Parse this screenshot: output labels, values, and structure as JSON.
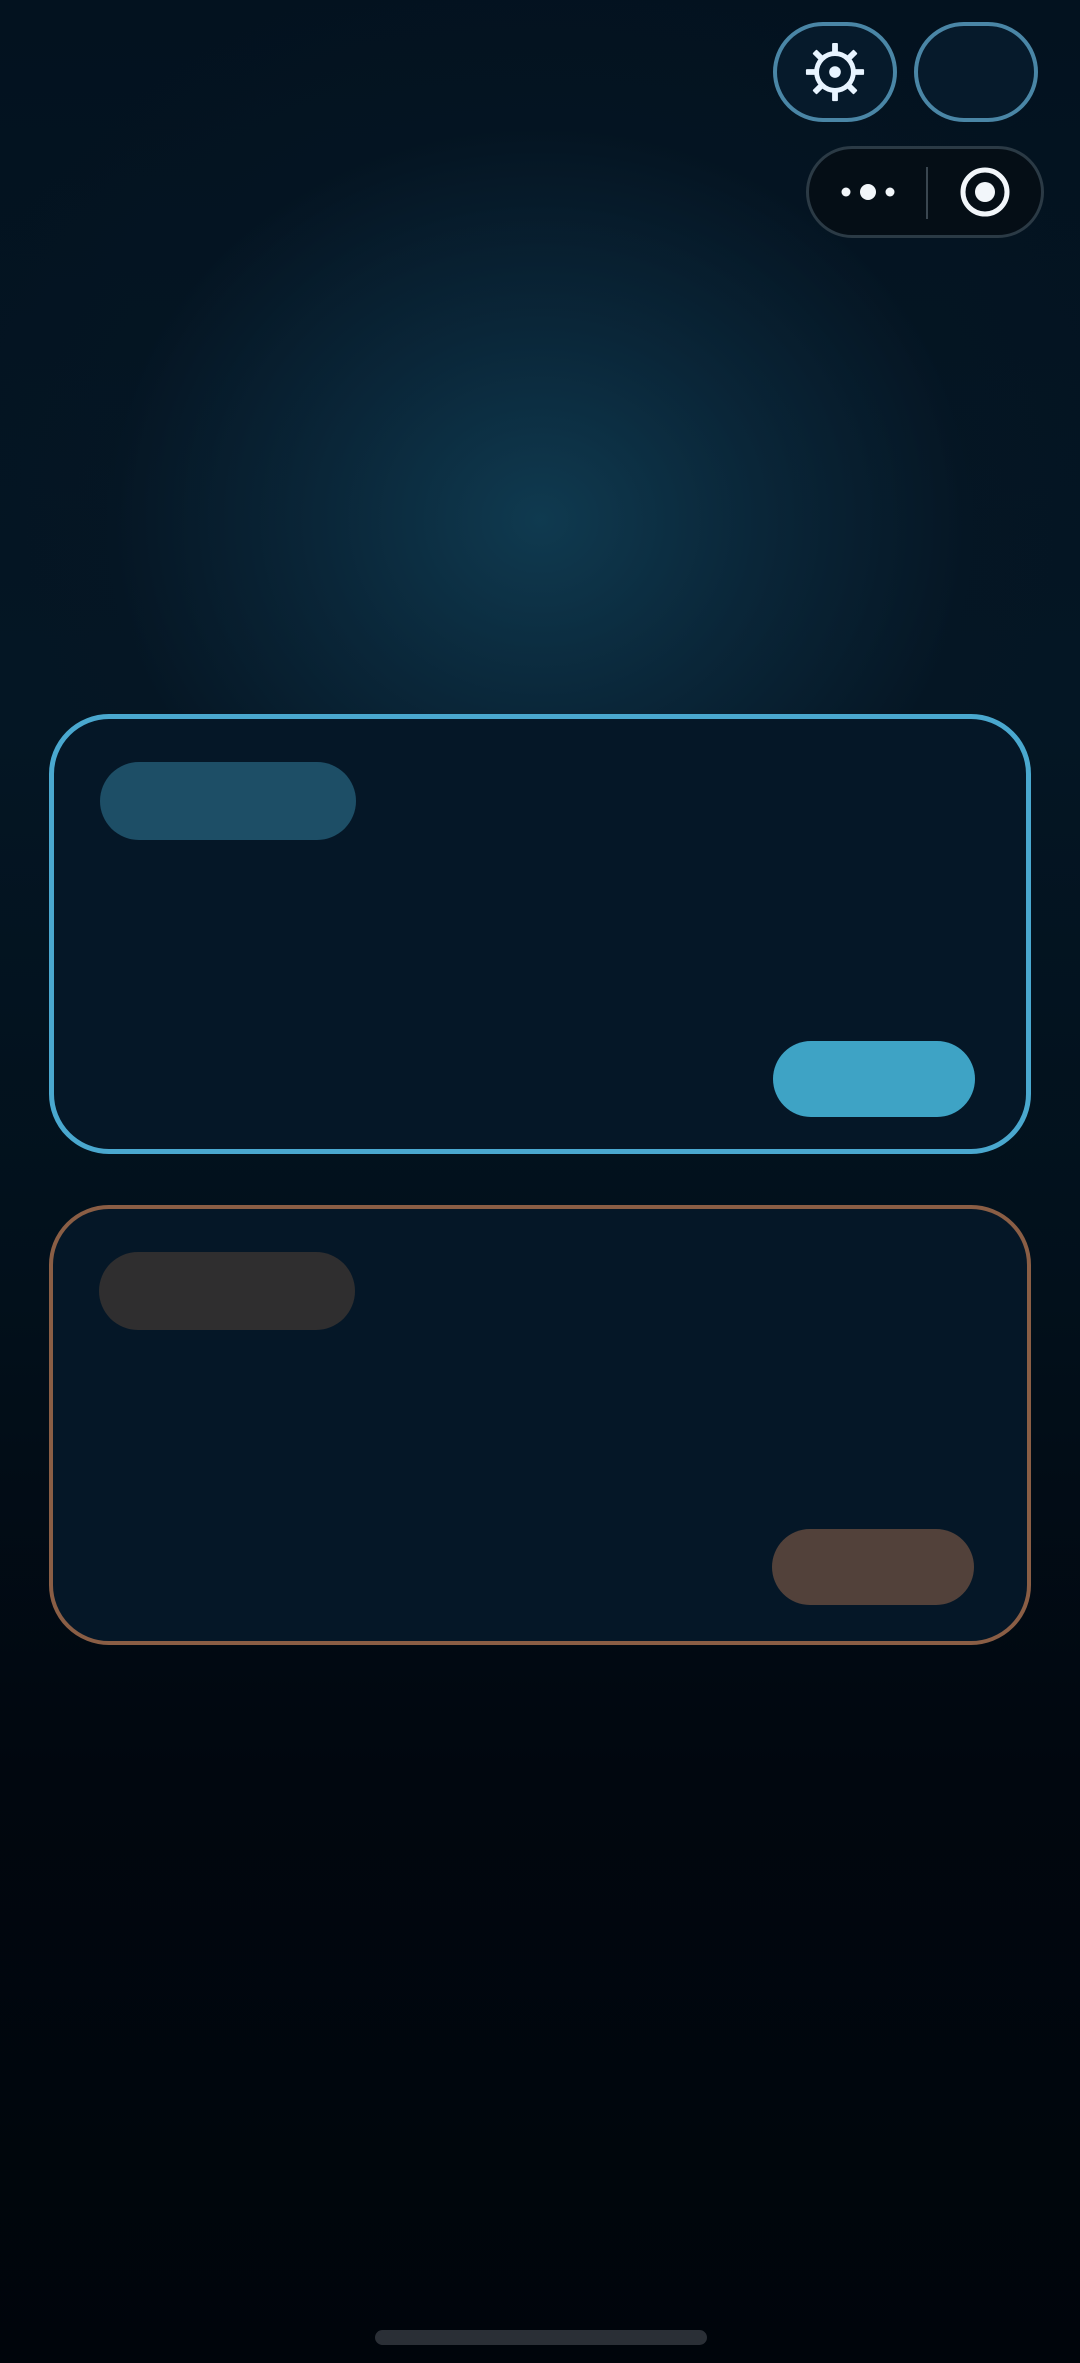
{
  "header": {
    "settings_icon": "gear-icon",
    "more_icon": "more-dots-icon",
    "close_icon": "target-circle-icon"
  },
  "cards": [
    {
      "tag_label": "",
      "action_label": "",
      "border_color": "#4aa8cf",
      "tag_color": "#1d4e66",
      "action_color": "#3ea3c5"
    },
    {
      "tag_label": "",
      "action_label": "",
      "border_color": "#8a5e45",
      "tag_color": "#2f2e2f",
      "action_color": "#52413a"
    }
  ],
  "colors": {
    "background": "#01060d",
    "accent_blue": "#4aa8cf",
    "accent_brown": "#8a5e45"
  }
}
